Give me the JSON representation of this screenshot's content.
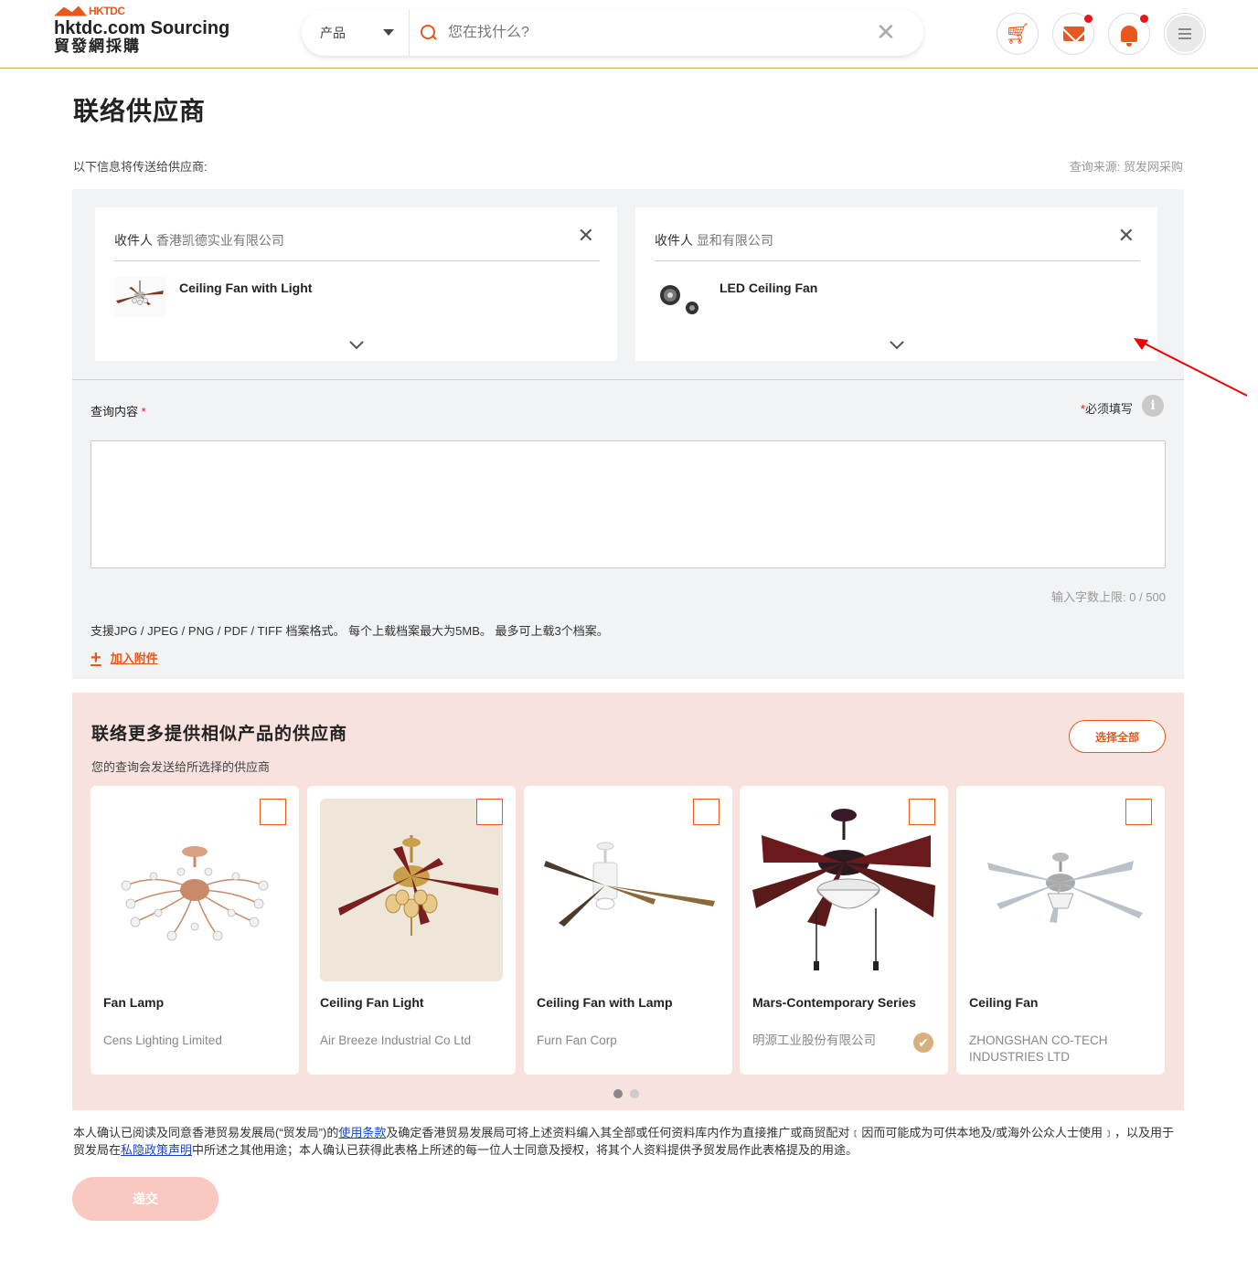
{
  "header": {
    "logo_small": "HKTDC",
    "logo_en": "hktdc.com Sourcing",
    "logo_zh": "貿發網採購",
    "search_category": "产品",
    "search_placeholder": "您在找什么?"
  },
  "page": {
    "title": "联络供应商",
    "info_label": "以下信息将传送给供应商:",
    "source": "查询来源: 贸发网采购"
  },
  "recipients": [
    {
      "prefix": "收件人",
      "company": "香港凯德实业有限公司",
      "product": "Ceiling Fan with Light"
    },
    {
      "prefix": "收件人",
      "company": "显和有限公司",
      "product": "LED Ceiling Fan"
    }
  ],
  "inquiry": {
    "label": "查询内容",
    "required_note": "必须填写",
    "char_count": "输入字数上限: 0 / 500",
    "formats_note": "支援JPG / JPEG / PNG / PDF / TIFF 档案格式。 每个上载档案最大为5MB。 最多可上载3个档案。",
    "add_attachment": "加入附件"
  },
  "similar": {
    "title": "联络更多提供相似产品的供应商",
    "subtitle": "您的查询会发送给所选择的供应商",
    "select_all": "选择全部",
    "cards": [
      {
        "name": "Fan Lamp",
        "supplier": "Cens Lighting Limited"
      },
      {
        "name": "Ceiling Fan Light",
        "supplier": "Air Breeze Industrial Co Ltd"
      },
      {
        "name": "Ceiling Fan with Lamp",
        "supplier": "Furn Fan Corp"
      },
      {
        "name": "Mars-Contemporary Series",
        "supplier": "明源工业股份有限公司"
      },
      {
        "name": "Ceiling Fan",
        "supplier": "ZHONGSHAN CO-TECH INDUSTRIES LTD"
      }
    ]
  },
  "consent": {
    "part1": "本人确认已阅读及同意香港贸易发展局(“贸发局”)的",
    "terms_link": "使用条款",
    "part2": "及确定香港贸易发展局可将上述资料编入其全部或任何资料库内作为直接推广或商贸配对﹝因而可能成为可供本地及/或海外公众人士使用﹞，以及用于贸发局在",
    "privacy_link": "私隐政策声明",
    "part3": "中所述之其他用途；本人确认已获得此表格上所述的每一位人士同意及授权，将其个人资料提供予贸发局作此表格提及的用途。"
  },
  "submit_label": "递交",
  "colors": {
    "accent": "#e8581c",
    "pink_bg": "#f7e2de",
    "panel_bg": "#f2f3f5"
  }
}
